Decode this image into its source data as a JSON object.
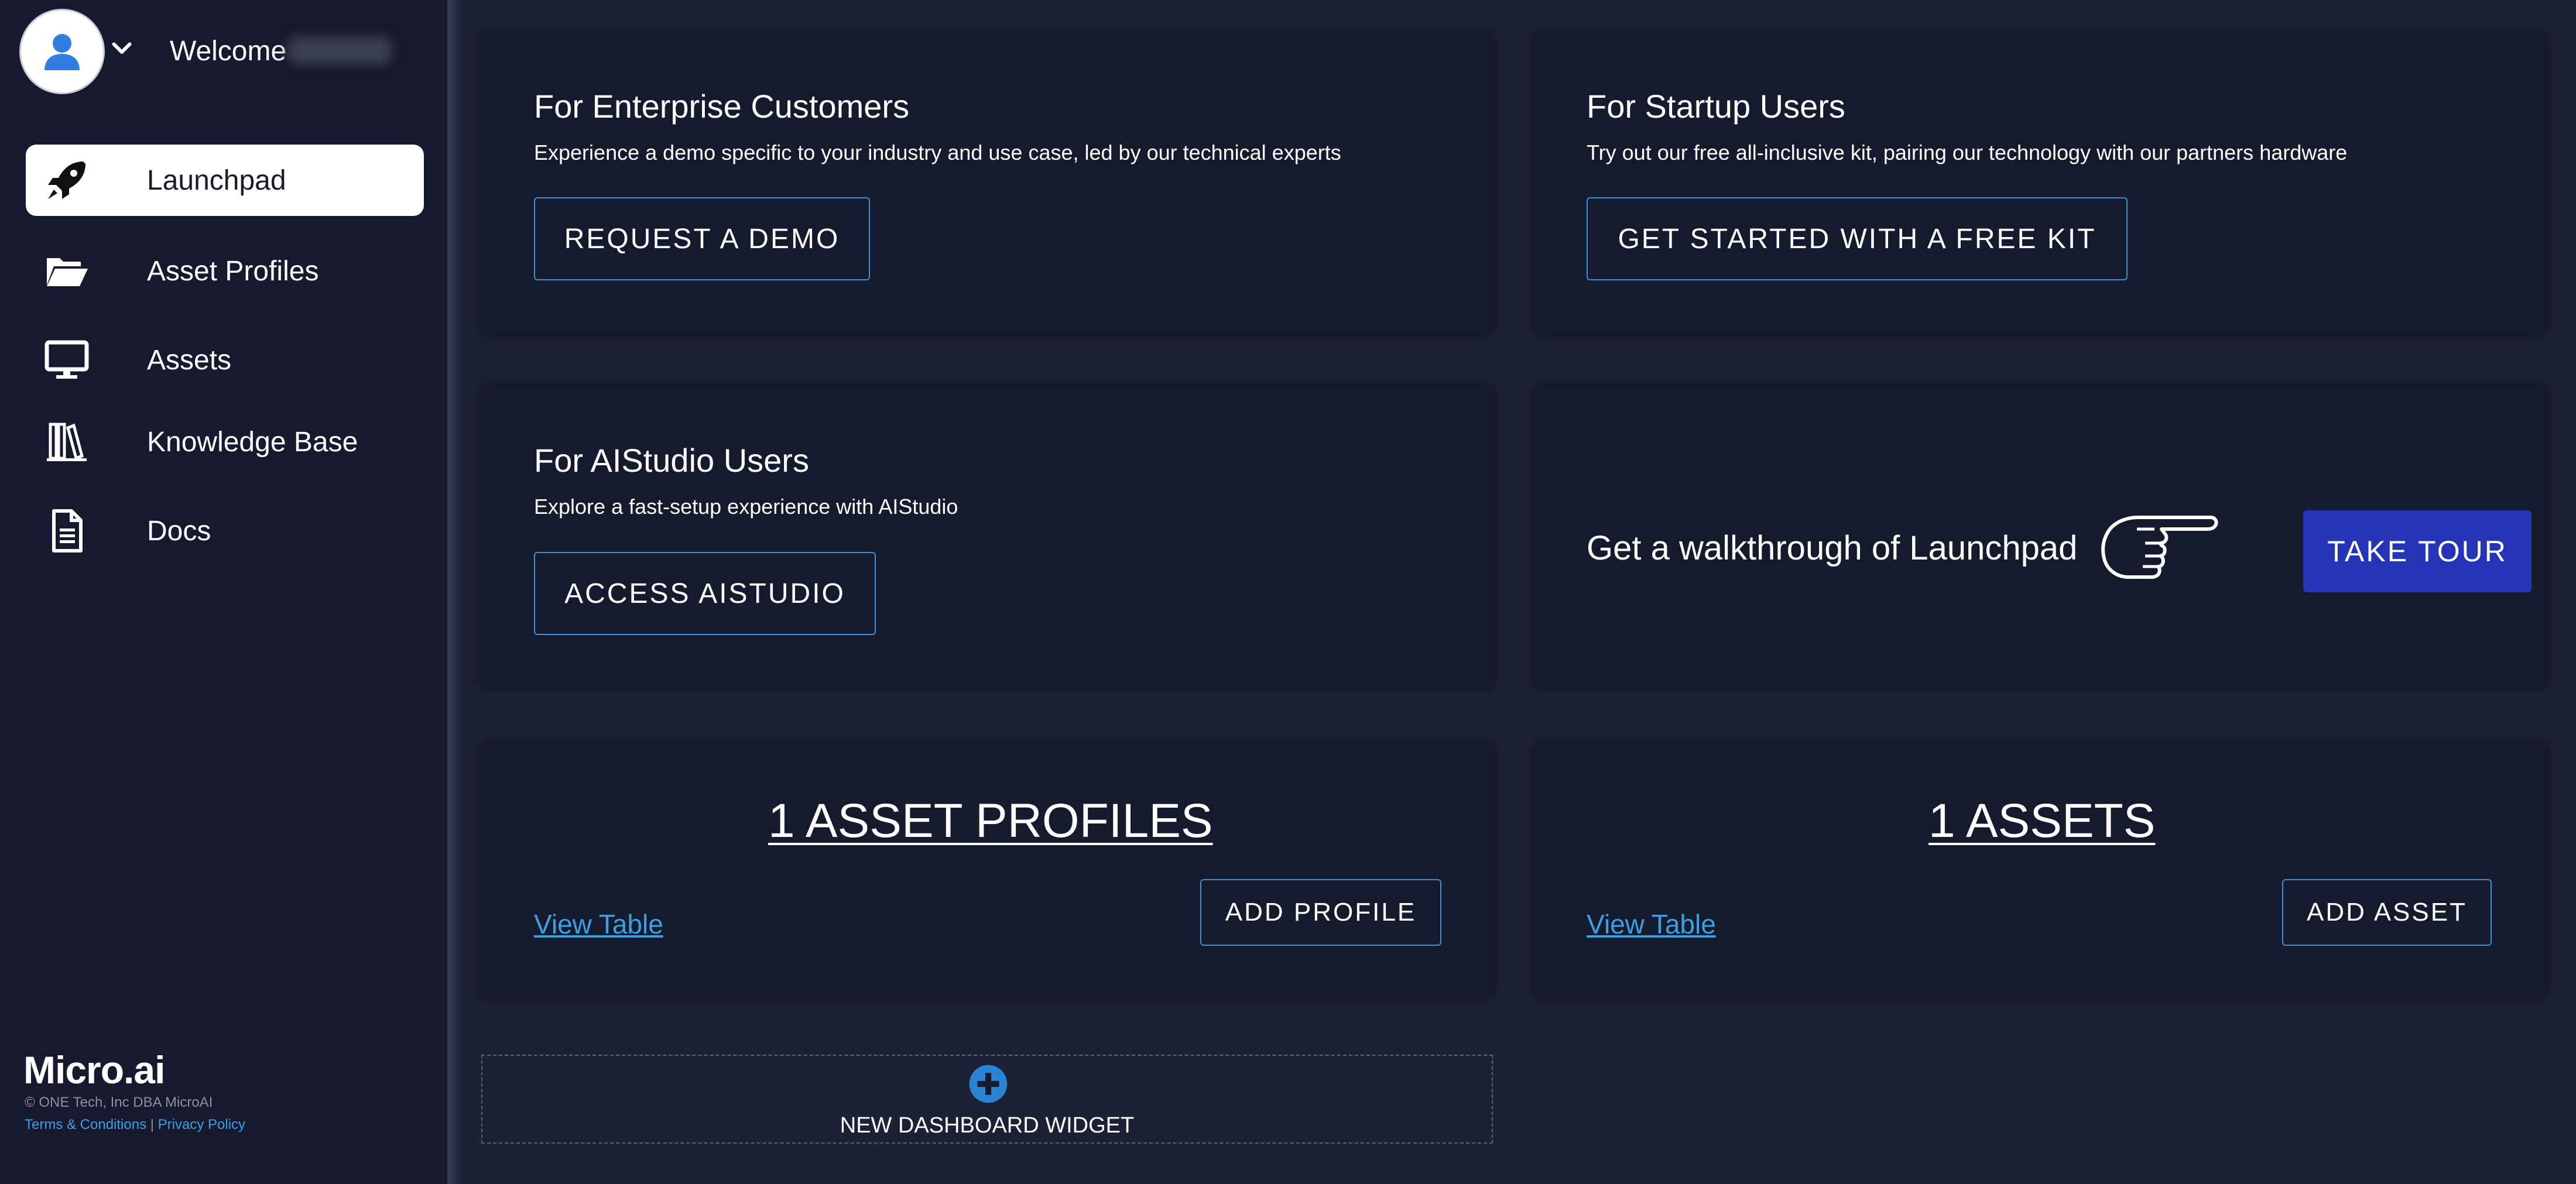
{
  "header": {
    "welcome_label": "Welcome"
  },
  "sidebar": {
    "items": [
      {
        "label": "Launchpad",
        "icon": "rocket-icon"
      },
      {
        "label": "Asset Profiles",
        "icon": "folder-open-icon"
      },
      {
        "label": "Assets",
        "icon": "monitor-icon"
      },
      {
        "label": "Knowledge Base",
        "icon": "books-icon"
      },
      {
        "label": "Docs",
        "icon": "document-icon"
      }
    ],
    "active": "Launchpad"
  },
  "footer": {
    "brand": "Micro.ai",
    "copyright": "© ONE Tech, Inc DBA MicroAI",
    "terms": "Terms & Conditions",
    "separator": "|",
    "privacy": "Privacy Policy"
  },
  "cards": {
    "enterprise": {
      "title": "For Enterprise Customers",
      "desc": "Experience a demo specific to your industry and use case, led by our technical experts",
      "button": "REQUEST A DEMO"
    },
    "startup": {
      "title": "For Startup Users",
      "desc": "Try out our free all-inclusive kit, pairing our technology with our partners hardware",
      "button": "GET STARTED WITH A FREE KIT"
    },
    "aistudio": {
      "title": "For AIStudio Users",
      "desc": "Explore a fast-setup experience with AIStudio",
      "button": "ACCESS AISTUDIO"
    },
    "tour": {
      "text": "Get a walkthrough of Launchpad",
      "button": "TAKE TOUR"
    },
    "profiles": {
      "count_label": "1 ASSET PROFILES",
      "view_link": "View Table",
      "button": "ADD PROFILE"
    },
    "assets": {
      "count_label": "1 ASSETS",
      "view_link": "View Table",
      "button": "ADD ASSET"
    }
  },
  "new_widget": {
    "label": "NEW DASHBOARD WIDGET"
  },
  "colors": {
    "background": "#1d2136",
    "sidebar": "#171a2e",
    "card": "#161a2d",
    "accent_blue": "#2634b8",
    "link_blue": "#3aa0e6",
    "button_border": "#3e8fd6"
  }
}
